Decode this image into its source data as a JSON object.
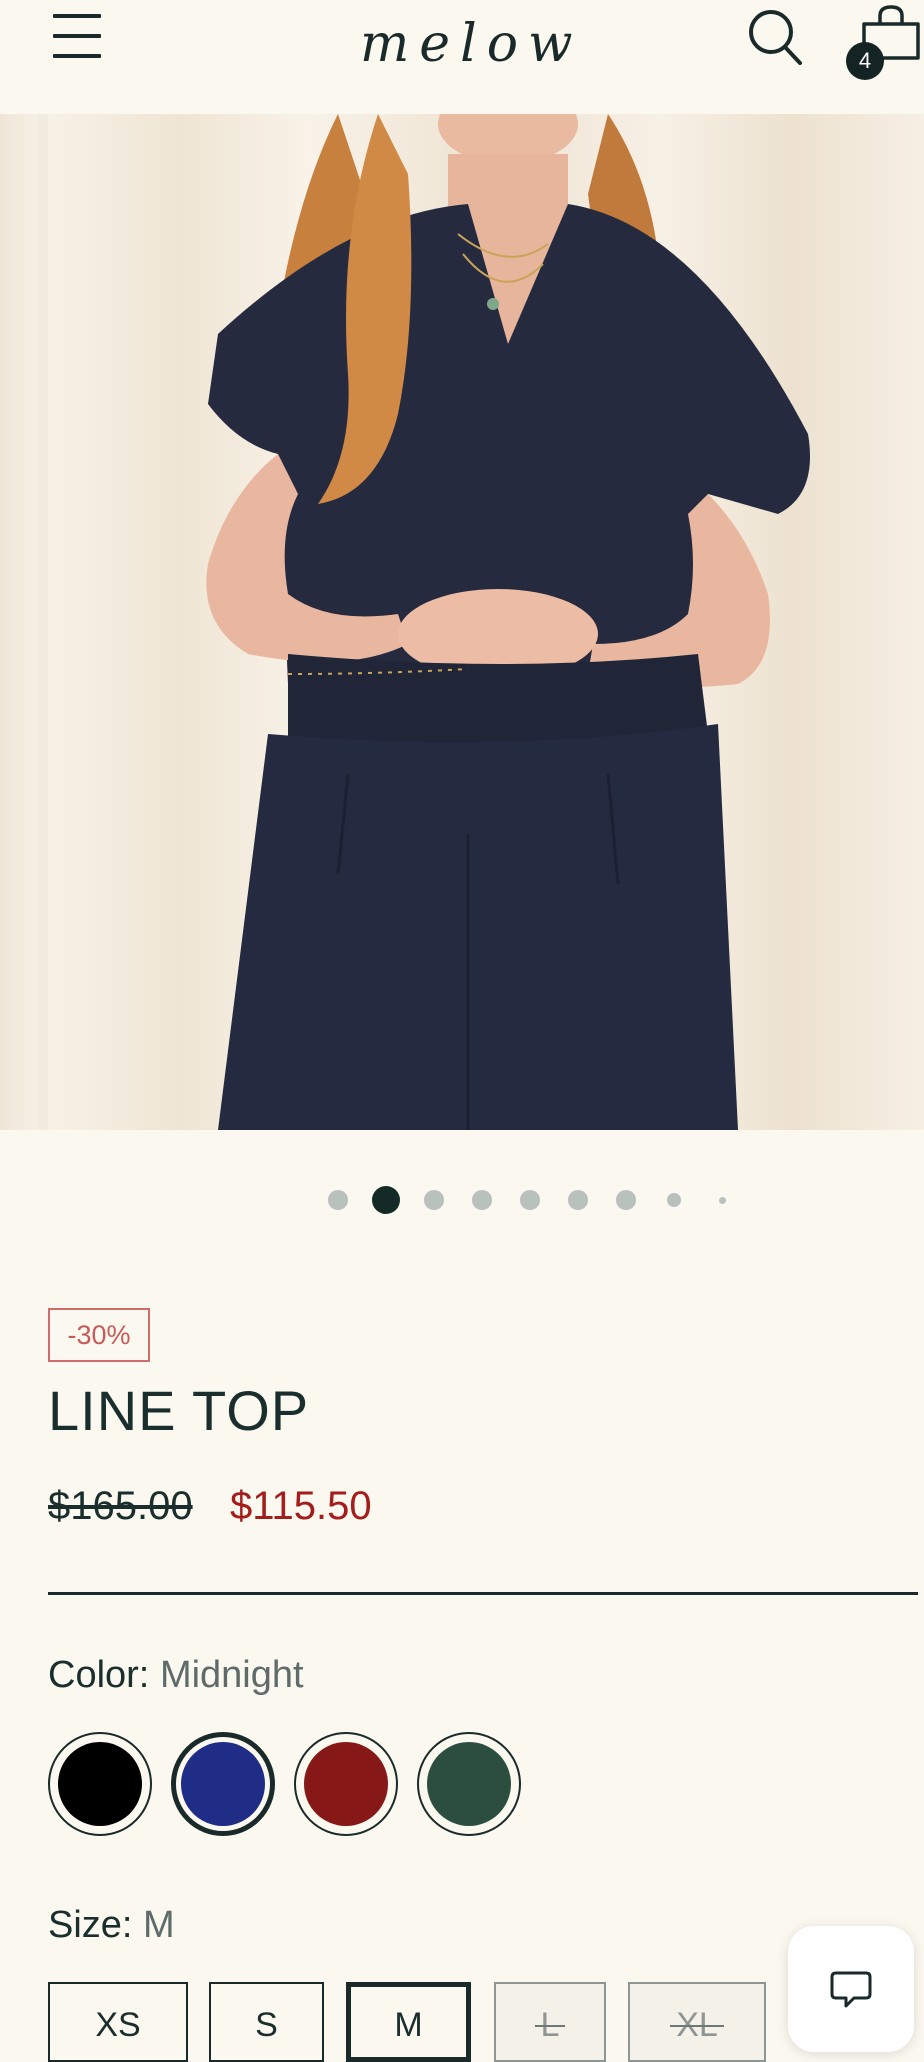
{
  "header": {
    "logo_text": "melow",
    "cart_count": "4"
  },
  "carousel": {
    "total_dots": 9,
    "active_index": 1
  },
  "product": {
    "discount": "-30%",
    "title": "LINE TOP",
    "price_original": "$165.00",
    "price_sale": "$115.50"
  },
  "color": {
    "label": "Color:",
    "selected": "Midnight",
    "swatches": [
      {
        "name": "black",
        "hex": "#000000"
      },
      {
        "name": "midnight",
        "hex": "#1f2d86"
      },
      {
        "name": "red",
        "hex": "#861818"
      },
      {
        "name": "green",
        "hex": "#2c4e3f"
      }
    ],
    "selected_index": 1
  },
  "size": {
    "label": "Size:",
    "selected": "M",
    "options": [
      {
        "label": "XS",
        "available": true
      },
      {
        "label": "S",
        "available": true
      },
      {
        "label": "M",
        "available": true,
        "selected": true
      },
      {
        "label": "L",
        "available": false
      },
      {
        "label": "XL",
        "available": false
      }
    ]
  },
  "colors": {
    "background": "#faf8ef",
    "text": "#1a2e2e",
    "sale": "#a41c1c",
    "discount_badge": "#d06b6b"
  }
}
